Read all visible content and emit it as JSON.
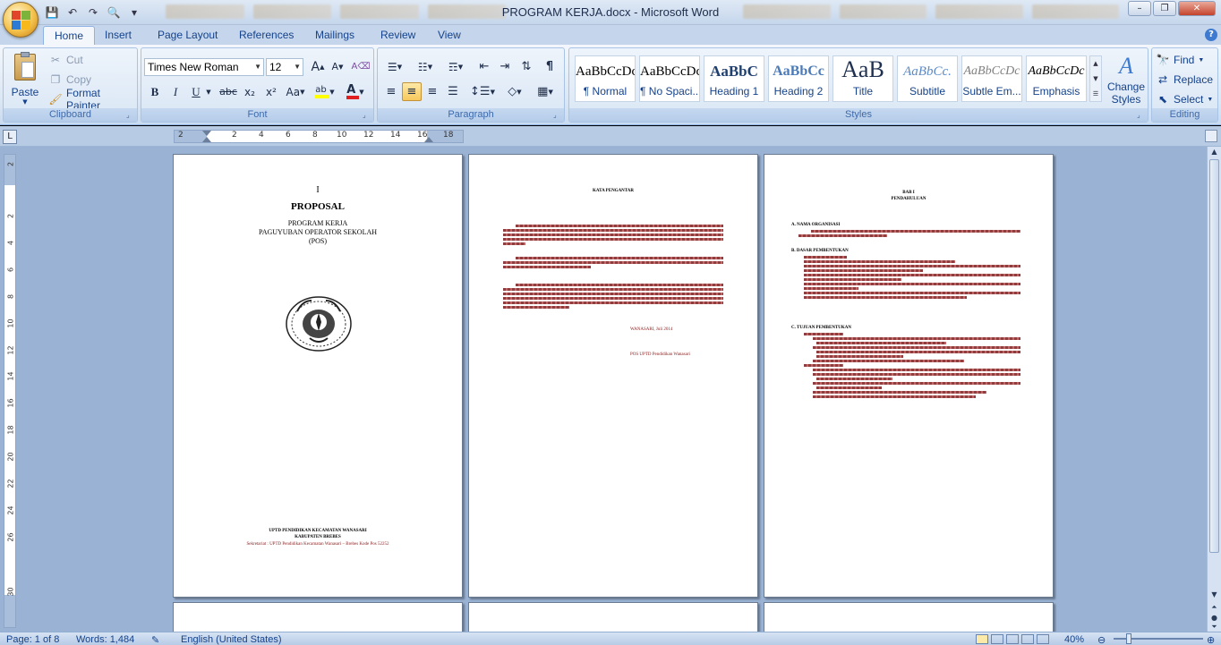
{
  "window": {
    "title": "PROGRAM KERJA.docx - Microsoft Word",
    "minimize": "–",
    "maximize": "❐",
    "close": "✕"
  },
  "qat": {
    "save": "💾",
    "undo": "↶",
    "redo": "↷",
    "print_preview": "🔍",
    "customize": "▾"
  },
  "tabs": [
    "Home",
    "Insert",
    "Page Layout",
    "References",
    "Mailings",
    "Review",
    "View"
  ],
  "clipboard": {
    "paste_label": "Paste",
    "cut_label": "Cut",
    "copy_label": "Copy",
    "format_painter_label": "Format Painter",
    "group_label": "Clipboard"
  },
  "font": {
    "font_name": "Times New Roman",
    "font_size": "12",
    "group_label": "Font",
    "bold": "B",
    "italic": "I",
    "underline": "U",
    "strikethrough": "abc",
    "subscript": "x₂",
    "superscript": "x²",
    "change_case": "Aa",
    "grow": "A",
    "shrink": "A"
  },
  "paragraph": {
    "group_label": "Paragraph"
  },
  "styles": {
    "group_label": "Styles",
    "items": [
      {
        "sample": "AaBbCcDc",
        "name": "¶ Normal"
      },
      {
        "sample": "AaBbCcDc",
        "name": "¶ No Spaci..."
      },
      {
        "sample": "AaBbC",
        "name": "Heading 1"
      },
      {
        "sample": "AaBbCc",
        "name": "Heading 2"
      },
      {
        "sample": "AaB",
        "name": "Title"
      },
      {
        "sample": "AaBbCc.",
        "name": "Subtitle"
      },
      {
        "sample": "AaBbCcDc",
        "name": "Subtle Em..."
      },
      {
        "sample": "AaBbCcDc",
        "name": "Emphasis"
      }
    ],
    "change_styles_label_1": "Change",
    "change_styles_label_2": "Styles"
  },
  "editing": {
    "group_label": "Editing",
    "find_label": "Find",
    "replace_label": "Replace",
    "select_label": "Select"
  },
  "ruler": {
    "corner": "L",
    "h_ticks": [
      "2",
      "2",
      "4",
      "6",
      "8",
      "10",
      "12",
      "14",
      "16",
      "18"
    ],
    "v_ticks": [
      "2",
      "2",
      "4",
      "6",
      "8",
      "10",
      "12",
      "14",
      "16",
      "18",
      "20",
      "22",
      "24",
      "26",
      "30"
    ]
  },
  "page1": {
    "cursor": "I",
    "title": "PROPOSAL",
    "subtitle1": "PROGRAM  KERJA",
    "subtitle2": "PAGUYUBAN OPERATOR  SEKOLAH",
    "subtitle3": "(POS)",
    "footer1": "UPTD PENDIDIKAN   KECAMATAN  WANASARI",
    "footer2": "KABUPATEN  BREBES",
    "footer3": "Sekretariat : UPTD Pendidikan Kecamatan Wanasari – Brebes Kode Pos 52252"
  },
  "page2": {
    "heading": "KATA PENGANTAR",
    "place_date": "WANASARI,        Juli 2014",
    "signature": "POS UPTD  Pendidikan Wanasari"
  },
  "page3": {
    "heading1": "BAB I",
    "heading2": "PENDAHULUAN",
    "sec_a": "A.  NAMA ORGANISASI",
    "sec_b": "B.  DASAR PEMBENTUKAN",
    "sec_c": "C.  TUJUAN PEMBENTUKAN"
  },
  "status": {
    "page": "Page: 1 of 8",
    "words": "Words: 1,484",
    "language": "English (United States)",
    "zoom": "40%"
  }
}
